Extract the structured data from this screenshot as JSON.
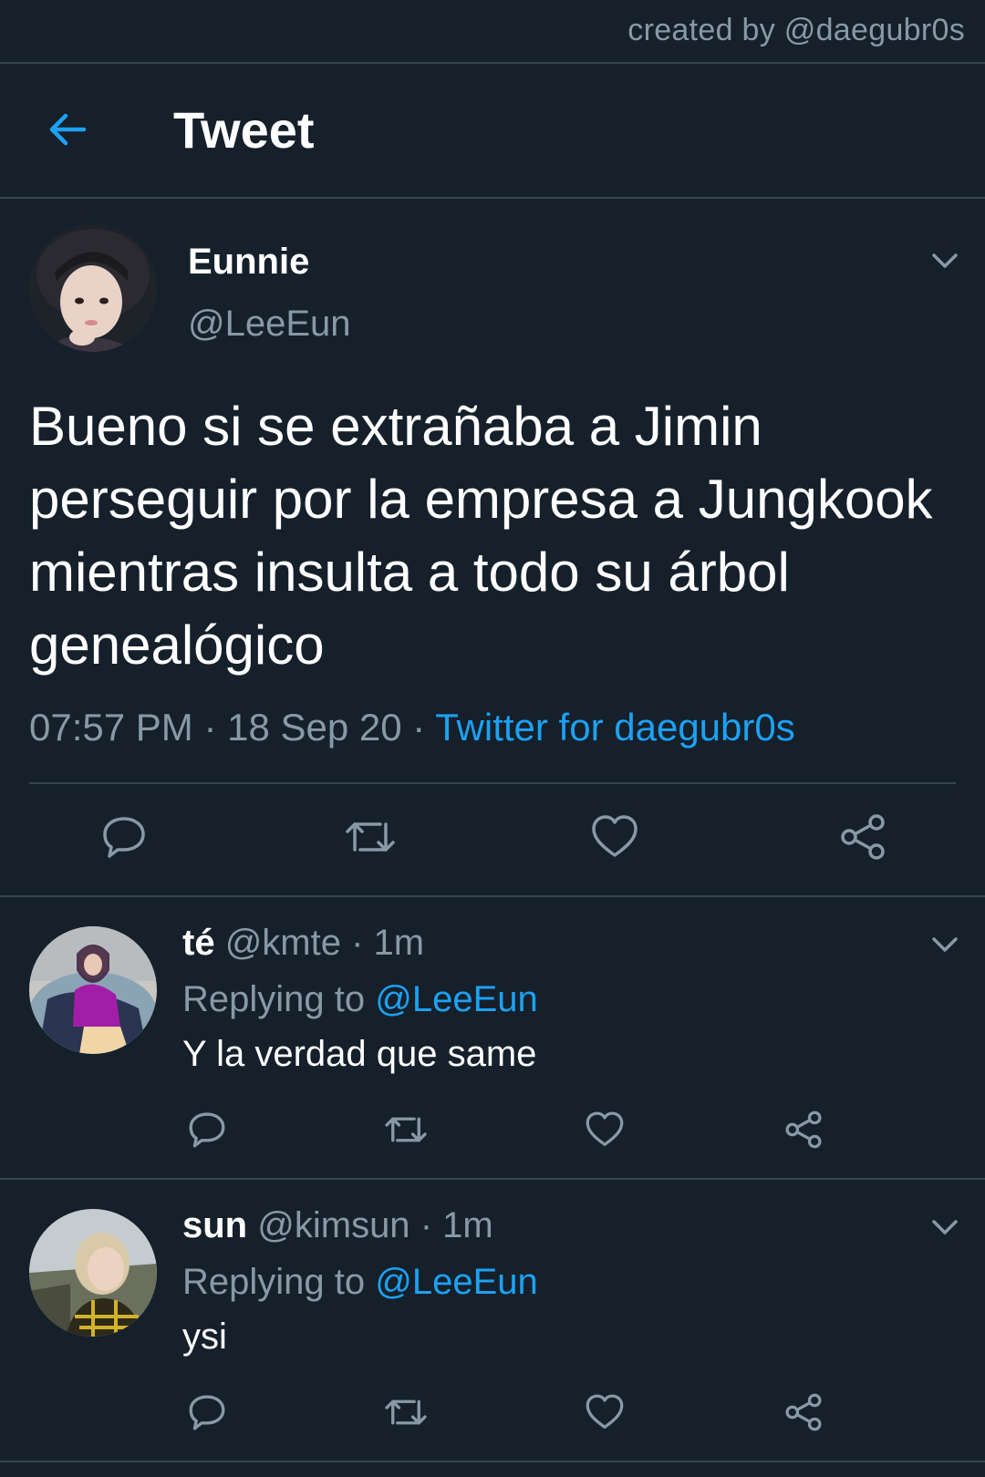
{
  "watermark": "created by @daegubr0s",
  "header": {
    "title": "Tweet",
    "back_icon": "arrow-left-icon"
  },
  "main_tweet": {
    "name": "Eunnie",
    "handle": "@LeeEun",
    "text": "Bueno si se extrañaba a Jimin perseguir por la empresa a Jungkook mientras insulta a todo su árbol genealógico",
    "time": "07:57 PM",
    "date": "18 Sep 20",
    "separator": " · ",
    "source": "Twitter for daegubr0s"
  },
  "replies": [
    {
      "name": "té",
      "handle": "@kmte",
      "age": "· 1m",
      "replying_label": "Replying to",
      "replying_to": "@LeeEun",
      "text": "Y la verdad que same"
    },
    {
      "name": "sun",
      "handle": "@kimsun",
      "age": "· 1m",
      "replying_label": "Replying to",
      "replying_to": "@LeeEun",
      "text": "ysi"
    }
  ],
  "colors": {
    "background": "#15202b",
    "divider": "#38444d",
    "secondary_text": "#8899a6",
    "accent": "#1da1f2"
  }
}
